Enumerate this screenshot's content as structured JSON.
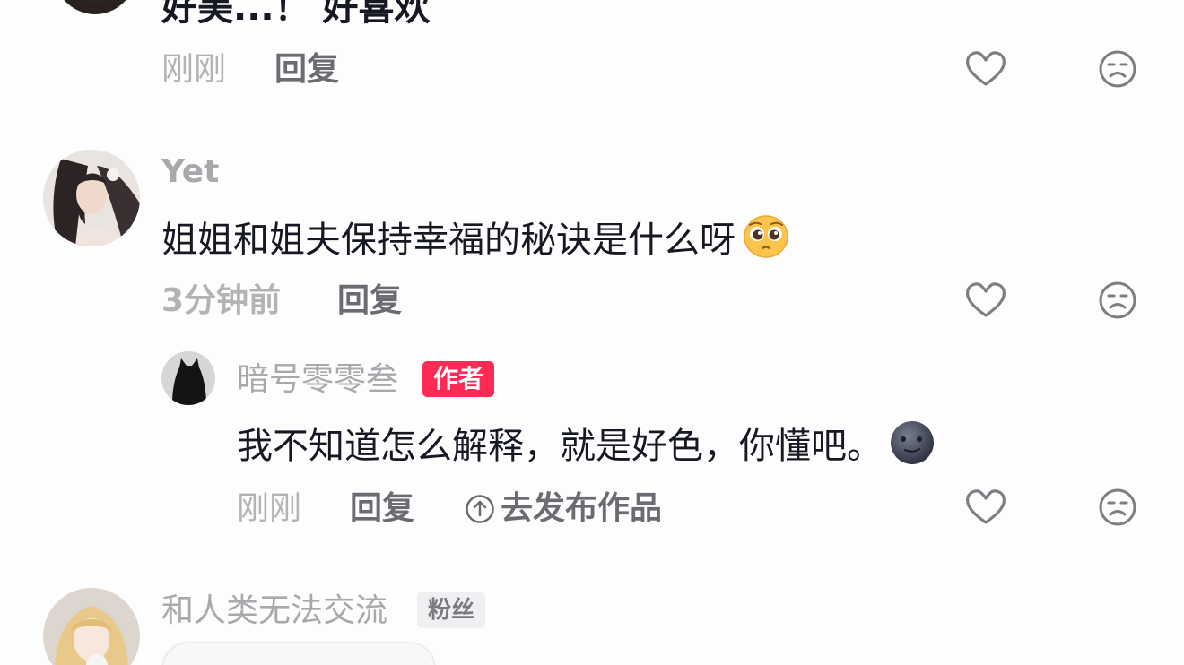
{
  "comments": [
    {
      "text": "好美...！ 好喜欢",
      "time": "刚刚",
      "reply_label": "回复"
    },
    {
      "username": "Yet",
      "text": "姐姐和姐夫保持幸福的秘诀是什么呀",
      "emoji": "pleading-face",
      "time": "3分钟前",
      "reply_label": "回复",
      "replies": [
        {
          "username": "暗号零零叁",
          "badge": "作者",
          "text": "我不知道怎么解释，就是好色，你懂吧。",
          "emoji": "new-moon-face",
          "time": "刚刚",
          "reply_label": "回复",
          "publish_label": "去发布作品"
        }
      ]
    },
    {
      "username": "和人类无法交流",
      "badge": "粉丝"
    }
  ],
  "colors": {
    "author_badge": "#fe2c55",
    "fan_badge_bg": "#f0f0f2",
    "text_primary": "#161823",
    "text_secondary": "#a9a9ad"
  },
  "icons": {
    "like": "heart-icon",
    "dislike": "unhappy-face-icon",
    "publish": "arrow-up-circle-icon"
  }
}
